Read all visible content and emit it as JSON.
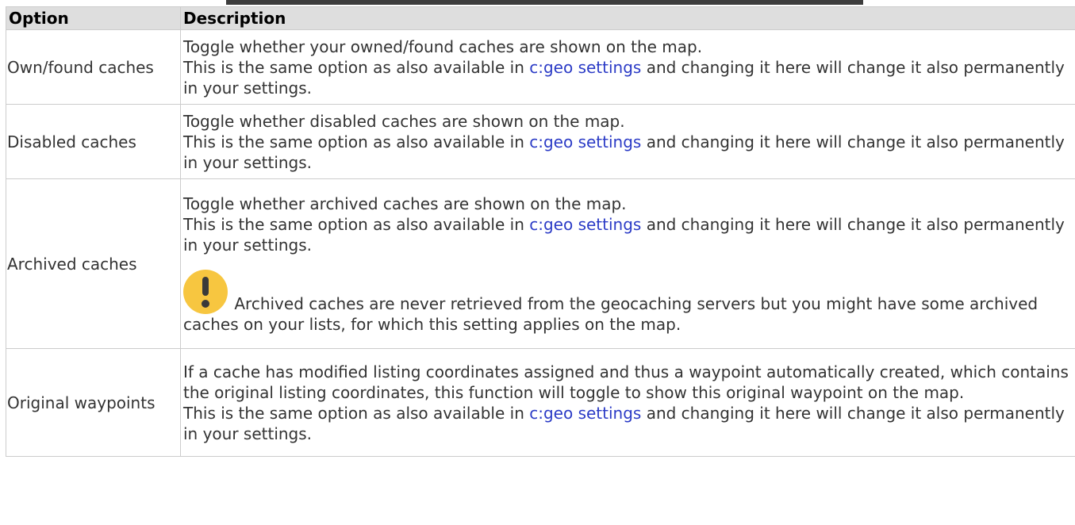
{
  "header": {
    "option": "Option",
    "description": "Description"
  },
  "rows": [
    {
      "option": "Own/found caches",
      "line1": "Toggle whether your owned/found caches are shown on the map.",
      "pre": "This is the same option as also available in ",
      "link": "c:geo settings",
      "post": " and changing it here will change it also permanently in your settings."
    },
    {
      "option": "Disabled caches",
      "line1": "Toggle whether disabled caches are shown on the map.",
      "pre": "This is the same option as also available in ",
      "link": "c:geo settings",
      "post": " and changing it here will change it also permanently in your settings."
    },
    {
      "option": "Archived caches",
      "line1": "Toggle whether archived caches are shown on the map.",
      "pre": "This is the same option as also available in ",
      "link": "c:geo settings",
      "post": " and changing it here will change it also permanently in your settings.",
      "note": " Archived caches are never retrieved from the geocaching servers but you might have some archived caches on your lists, for which this setting applies on the map.",
      "note_icon": "exclamation-icon"
    },
    {
      "option": "Original waypoints",
      "line1": "If a cache has modified listing coordinates assigned and thus a waypoint automatically created, which contains the original listing coordinates, this function will toggle to show this original waypoint on the map.",
      "pre": "This is the same option as also available in ",
      "link": "c:geo settings",
      "post": " and changing it here will change it also permanently in your settings."
    }
  ],
  "colors": {
    "header_bg": "#dedede",
    "link": "#2b3bc6",
    "warn_icon": "#f7c640",
    "top_bar": "#3d3d3d"
  }
}
